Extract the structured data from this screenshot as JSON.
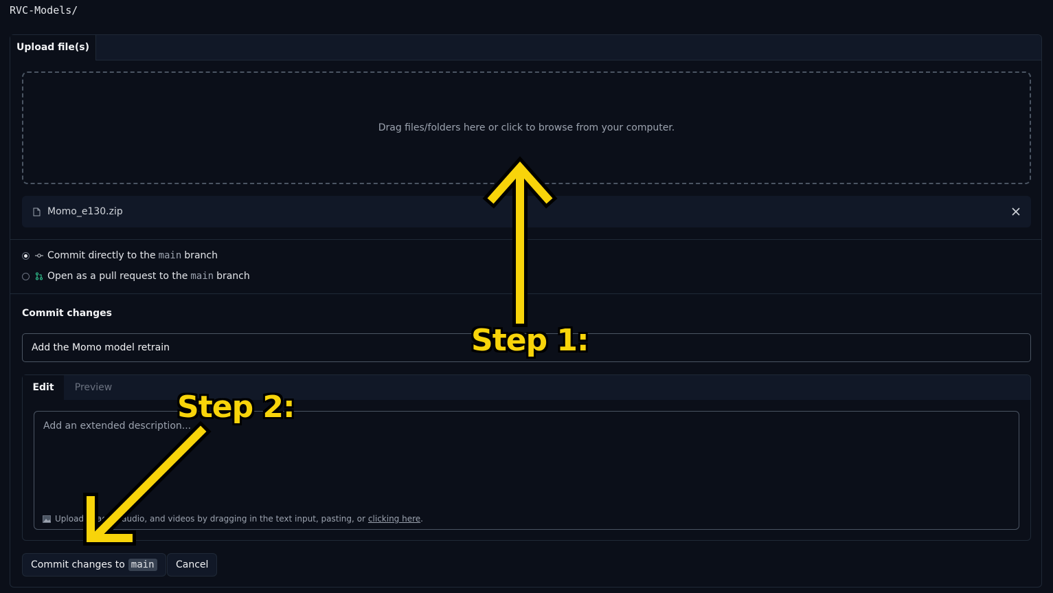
{
  "path": "RVC-Models/",
  "upload_tab": {
    "label": "Upload file(s)"
  },
  "dropzone": {
    "text": "Drag files/folders here or click to browse from your computer."
  },
  "file": {
    "name": "Momo_e130.zip"
  },
  "commit_options": [
    {
      "prefix": "Commit directly to the",
      "branch": "main",
      "suffix": "branch",
      "selected": true
    },
    {
      "prefix": "Open as a pull request to the",
      "branch": "main",
      "suffix": "branch",
      "selected": false
    }
  ],
  "commit": {
    "heading": "Commit changes",
    "title_value": "Add the Momo model retrain"
  },
  "editor": {
    "tab_edit": "Edit",
    "tab_preview": "Preview",
    "placeholder": "Add an extended description...",
    "footer_text": "Upload images, audio, and videos by dragging in the text input, pasting, or",
    "footer_link": "clicking here",
    "footer_end": "."
  },
  "buttons": {
    "commit_label": "Commit changes to",
    "commit_branch": "main",
    "cancel_label": "Cancel"
  },
  "annotations": {
    "step1": "Step 1:",
    "step2": "Step 2:",
    "arrow_color": "#f8d40a"
  }
}
